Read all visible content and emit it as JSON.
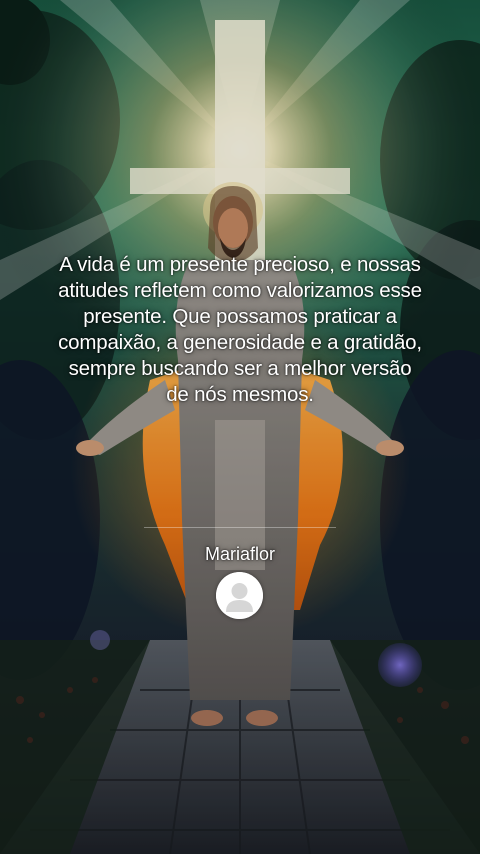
{
  "post": {
    "quote_text": "A vida é um presente precioso, e nossas atitudes refletem como valorizamos esse presente. Que possamos praticar a compaixão, a generosidade e a gratidão, sempre buscando ser a melhor versão de nós mesmos.",
    "author_name": "Mariaflor"
  },
  "background": {
    "icon": "jesus-open-arms-image",
    "colors": {
      "sky_green": "#1f6a4c",
      "light_glow": "#fff6d8",
      "robe_orange": "#f08a1e",
      "robe_grey": "#8a8683",
      "path_stone": "#2a3038",
      "flowers_red": "#c8262a",
      "bokeh_purple": "#7b6bd8"
    }
  },
  "avatar": {
    "icon": "default-user-avatar-icon"
  }
}
